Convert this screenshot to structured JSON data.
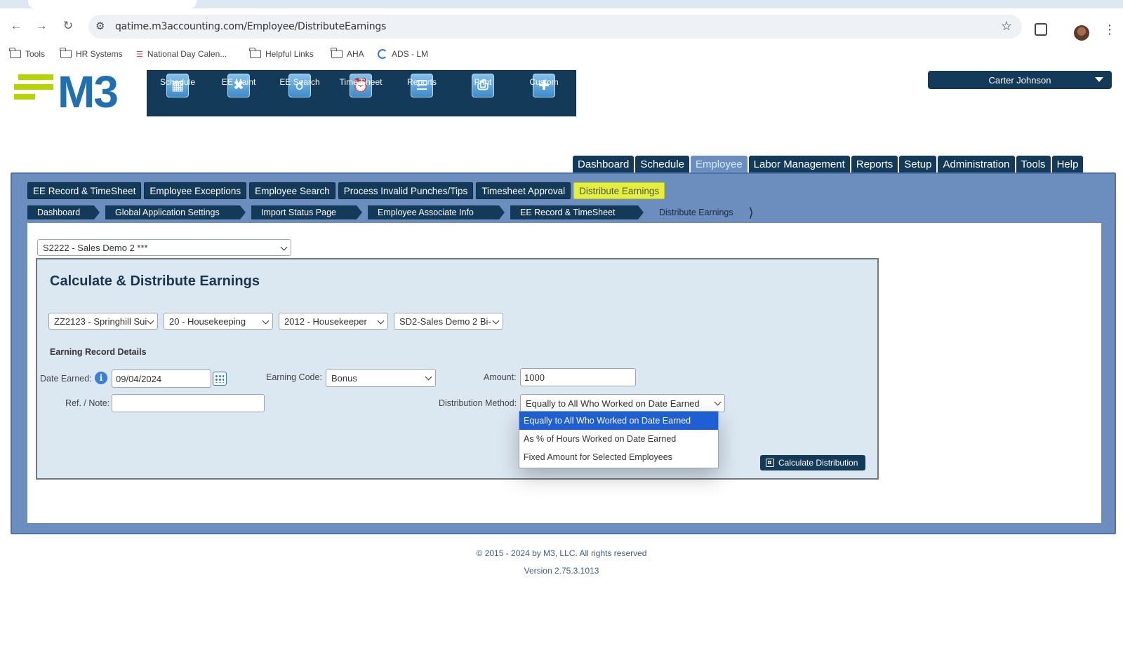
{
  "browser": {
    "url": "qatime.m3accounting.com/Employee/DistributeEarnings",
    "bookmarks": [
      {
        "label": "Tools",
        "icon": "folder-icon"
      },
      {
        "label": "HR Systems",
        "icon": "folder-icon"
      },
      {
        "label": "National Day Calen...",
        "icon": "national-day-icon"
      },
      {
        "label": "Helpful Links",
        "icon": "folder-icon"
      },
      {
        "label": "AHA",
        "icon": "folder-icon"
      },
      {
        "label": "ADS - LM",
        "icon": "ads-icon"
      }
    ]
  },
  "logo": {
    "text": "M3",
    "accent": "#b6d400",
    "brand": "#1e6fb3"
  },
  "toolbar": {
    "items": [
      {
        "label": "Schedule",
        "icon": "calendar-icon"
      },
      {
        "label": "EE Maint",
        "icon": "wrench-icon"
      },
      {
        "label": "EE Search",
        "icon": "magnifier-icon"
      },
      {
        "label": "Time Sheet",
        "icon": "alarm-clock-icon"
      },
      {
        "label": "Reports",
        "icon": "report-icon"
      },
      {
        "label": "Print",
        "icon": "printer-icon"
      },
      {
        "label": "Custom",
        "icon": "plus-icon"
      }
    ]
  },
  "user": {
    "name": "Carter Johnson"
  },
  "main_tabs": [
    "Dashboard",
    "Schedule",
    "Employee",
    "Labor Management",
    "Reports",
    "Setup",
    "Administration",
    "Tools",
    "Help"
  ],
  "main_tabs_active": "Employee",
  "sub_tabs": [
    "EE Record & TimeSheet",
    "Employee Exceptions",
    "Employee Search",
    "Process Invalid Punches/Tips",
    "Timesheet Approval",
    "Distribute Earnings"
  ],
  "sub_tabs_active": "Distribute Earnings",
  "breadcrumbs": [
    "Dashboard",
    "Global Application Settings",
    "Import Status Page",
    "Employee Associate Info",
    "EE Record & TimeSheet",
    "Distribute Earnings"
  ],
  "company_select": "S2222 - Sales Demo 2 ***",
  "panel": {
    "title": "Calculate & Distribute Earnings",
    "filters": [
      "ZZ2123 - Springhill Sui",
      "20 - Housekeeping",
      "2012 - Housekeeper",
      "SD2-Sales Demo 2 Bi-"
    ],
    "section_label": "Earning Record Details",
    "date_earned_label": "Date Earned:",
    "date_earned_value": "09/04/2024",
    "earning_code_label": "Earning Code:",
    "earning_code_value": "Bonus",
    "amount_label": "Amount:",
    "amount_value": "1000",
    "ref_note_label": "Ref. / Note:",
    "ref_note_value": "",
    "distribution_label": "Distribution Method:",
    "distribution_value": "Equally to All Who Worked on Date Earned",
    "distribution_options": [
      "Equally to All Who Worked on Date Earned",
      "As % of Hours Worked on Date Earned",
      "Fixed Amount for Selected Employees"
    ],
    "calc_button": "Calculate Distribution"
  },
  "footer": {
    "copyright": "© 2015 - 2024 by M3, LLC. All rights reserved",
    "version": "Version 2.75.3.1013"
  },
  "colors": {
    "navy": "#143a59",
    "frame": "#6c8ebf",
    "highlight": "#e3ef38",
    "selected": "#1f5fd6"
  }
}
